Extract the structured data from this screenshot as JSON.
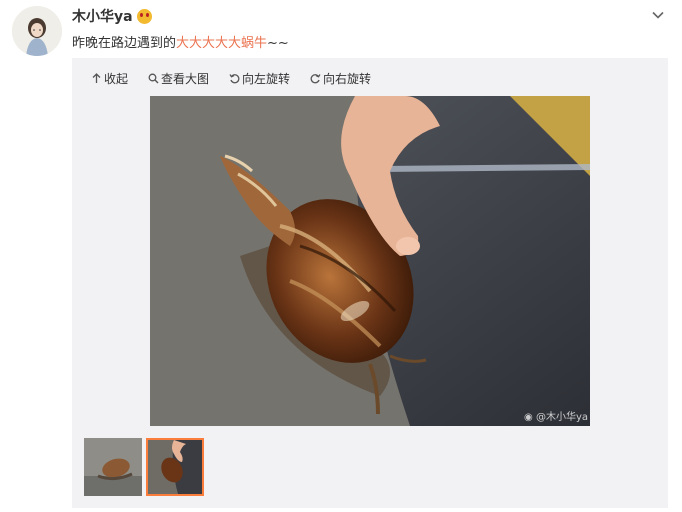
{
  "post": {
    "username": "木小华ya",
    "text_before": "昨晚在路边遇到的",
    "text_highlight": "大大大大大蜗牛",
    "text_after": "~~"
  },
  "toolbar": {
    "collapse_label": "收起",
    "view_large_label": "查看大图",
    "rotate_left_label": "向左旋转",
    "rotate_right_label": "向右旋转"
  },
  "photo": {
    "watermark": "@木小华ya"
  },
  "icons": {
    "avatar": "user-avatar",
    "emoji": "blushing-face-icon",
    "menu": "chevron-down-icon",
    "collapse": "arrow-up-icon",
    "view_large": "search-icon",
    "rotate_left": "rotate-left-icon",
    "rotate_right": "rotate-right-icon",
    "watermark_logo": "weibo-logo-icon"
  },
  "colors": {
    "highlight": "#eb7350",
    "media_background": "#f2f2f5",
    "selected_thumb_border": "#fa7d3c"
  }
}
